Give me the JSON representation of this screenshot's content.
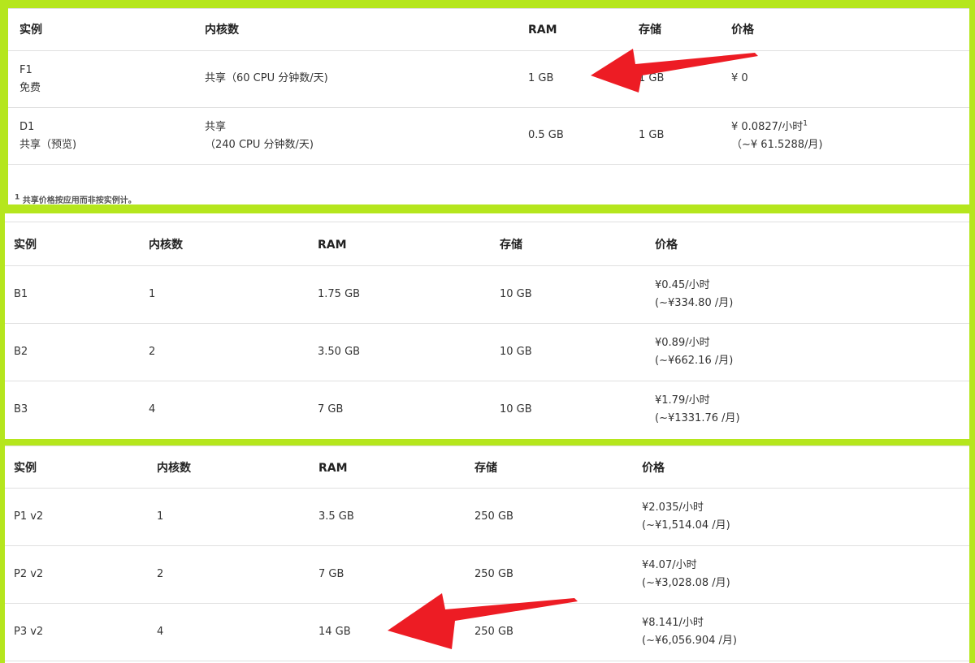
{
  "tables": [
    {
      "headers": [
        "实例",
        "内核数",
        "RAM",
        "存储",
        "价格"
      ],
      "rows": [
        {
          "instance": [
            "F1",
            "免费"
          ],
          "cores": [
            "共享（60 CPU 分钟数/天)"
          ],
          "ram": "1 GB",
          "storage": "1 GB",
          "price": [
            "¥ 0"
          ]
        },
        {
          "instance": [
            "D1",
            "共享（预览)"
          ],
          "cores": [
            "共享",
            "（240 CPU 分钟数/天)"
          ],
          "ram": "0.5 GB",
          "storage": "1 GB",
          "price": [
            "¥  0.0827/小时",
            "（~¥  61.5288/月)"
          ],
          "price_footnote": "1"
        }
      ],
      "footnote_marker": "1",
      "footnote": "共享价格按应用而非按实例计。"
    },
    {
      "headers": [
        "实例",
        "内核数",
        "RAM",
        "存储",
        "价格"
      ],
      "rows": [
        {
          "instance": [
            "B1"
          ],
          "cores": [
            "1"
          ],
          "ram": "1.75 GB",
          "storage": "10 GB",
          "price": [
            "¥0.45/小时",
            "(~¥334.80 /月)"
          ]
        },
        {
          "instance": [
            "B2"
          ],
          "cores": [
            "2"
          ],
          "ram": "3.50 GB",
          "storage": "10 GB",
          "price": [
            "¥0.89/小时",
            "(~¥662.16 /月)"
          ]
        },
        {
          "instance": [
            "B3"
          ],
          "cores": [
            "4"
          ],
          "ram": "7 GB",
          "storage": "10 GB",
          "price": [
            "¥1.79/小时",
            "(~¥1331.76 /月)"
          ]
        }
      ]
    },
    {
      "headers": [
        "实例",
        "内核数",
        "RAM",
        "存储",
        "价格"
      ],
      "rows": [
        {
          "instance": [
            "P1 v2"
          ],
          "cores": [
            "1"
          ],
          "ram": "3.5 GB",
          "storage": "250 GB",
          "price": [
            "¥2.035/小时",
            "(~¥1,514.04 /月)"
          ]
        },
        {
          "instance": [
            "P2 v2"
          ],
          "cores": [
            "2"
          ],
          "ram": "7 GB",
          "storage": "250 GB",
          "price": [
            "¥4.07/小时",
            "(~¥3,028.08 /月)"
          ]
        },
        {
          "instance": [
            "P3 v2"
          ],
          "cores": [
            "4"
          ],
          "ram": "14 GB",
          "storage": "250 GB",
          "price": [
            "¥8.141/小时",
            "(~¥6,056.904 /月)"
          ]
        }
      ]
    }
  ],
  "colors": {
    "page_background": "#b5e61d",
    "panel_background": "#ffffff",
    "arrow": "#ed1c24",
    "divider": "#e0e0e0"
  }
}
